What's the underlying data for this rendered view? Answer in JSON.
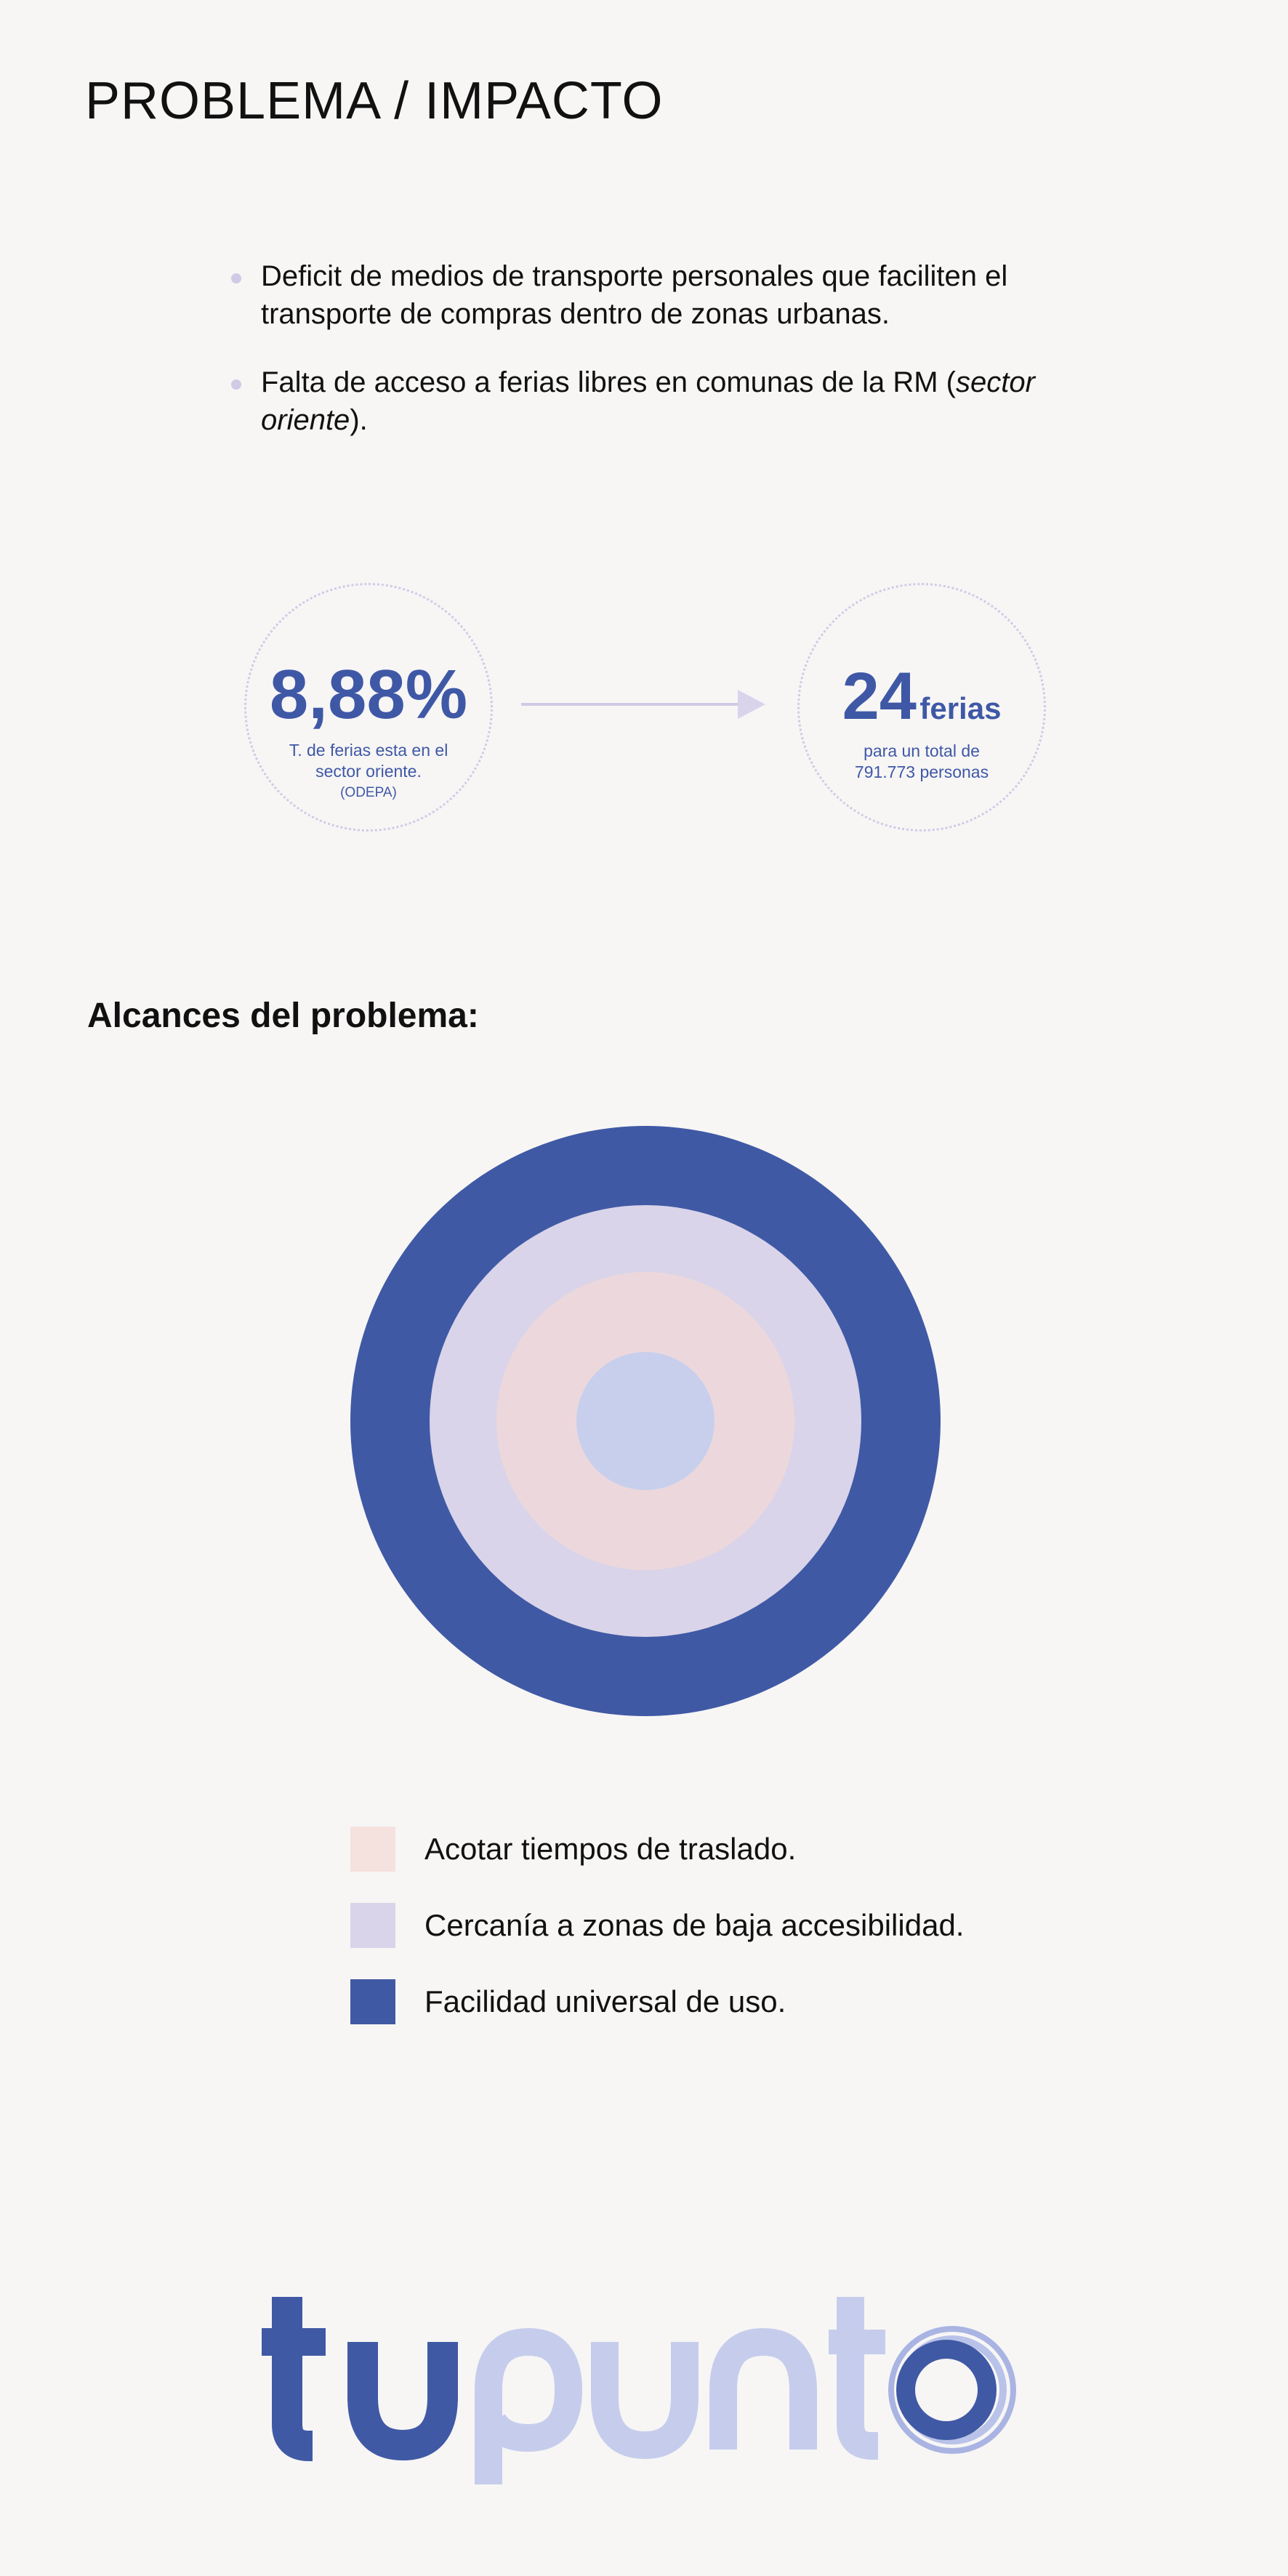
{
  "page": {
    "title": "PROBLEMA / IMPACTO"
  },
  "bullets": [
    "Deficit de medios de transporte personales que faciliten el transporte de compras dentro de zonas urbanas.",
    {
      "text_before": "Falta de acceso a ferias libres en comunas de la RM (",
      "text_italic": "sector oriente",
      "text_after": ")."
    }
  ],
  "stats": {
    "left": {
      "value": "8,88%",
      "description": "T. de ferias esta en el sector oriente.",
      "source": "(ODEPA)"
    },
    "arrow_icon": "arrow-right-icon",
    "right": {
      "value": "24",
      "unit": "ferias",
      "description": "para un total de 791.773 personas"
    }
  },
  "scope": {
    "title": "Alcances del problema:",
    "rings": [
      {
        "color": "#4059a5"
      },
      {
        "color": "#d9d4e9"
      },
      {
        "color": "#ecd8dc"
      },
      {
        "color": "#c7cfec"
      }
    ],
    "legend": [
      {
        "label": "Acotar tiempos de traslado.",
        "color": "#f5e1de"
      },
      {
        "label": "Cercanía a zonas de baja accesibilidad.",
        "color": "#d9d4e9"
      },
      {
        "label": "Facilidad universal de uso.",
        "color": "#4059a5"
      }
    ]
  },
  "logo": {
    "text": "tupunto",
    "color_dark": "#4059a5",
    "color_light": "#c6cdec"
  }
}
